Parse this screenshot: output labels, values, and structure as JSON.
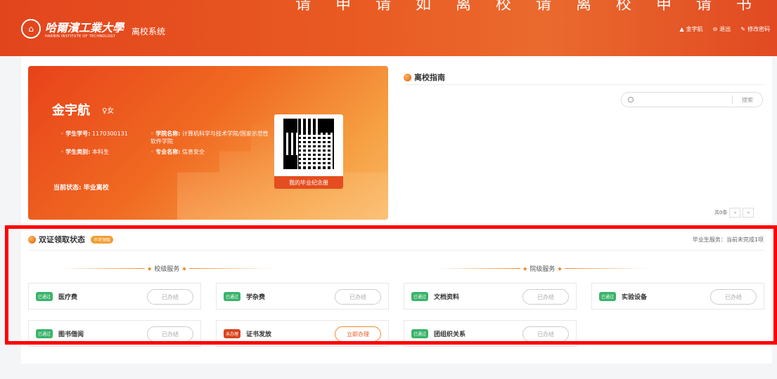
{
  "header": {
    "caption": "请 申 请 如 离 校 请 离 校 申 请 书",
    "logo_cn": "哈爾濱工業大學",
    "logo_en": "HARBIN INSTITUTE OF TECHNOLOGY",
    "system_title": "离校系统",
    "user_name": "金宇航",
    "logout_label": "退出",
    "change_password_label": "修改密码"
  },
  "student_card": {
    "name": "金宇航",
    "gender": "♀女",
    "student_id_label": "学生学号:",
    "student_id": "1170300131",
    "student_type_label": "学生类别:",
    "student_type": "本科生",
    "college_label": "学院名称:",
    "college": "计算机科学与技术学院/国家示范性软件学院",
    "major_label": "专业名称:",
    "major": "信息安全",
    "status_label": "当前状态:",
    "status": "毕业离校",
    "qr_caption": "我的毕业纪念册"
  },
  "guide": {
    "title": "离校指南",
    "search_placeholder": "",
    "search_button": "搜索",
    "total": "共0条",
    "prev": "«",
    "next": "»"
  },
  "certificates": {
    "title": "双证领取状态",
    "badge": "不可领取",
    "summary": "毕业生服务：当前未完成1项",
    "school_section": "校级服务",
    "college_section": "院级服务",
    "items": [
      {
        "tag": "已通过",
        "label": "医疗费",
        "action": "已办结"
      },
      {
        "tag": "已通过",
        "label": "学杂费",
        "action": "已办结"
      },
      {
        "tag": "已通过",
        "label": "文档资料",
        "action": "已办结"
      },
      {
        "tag": "已通过",
        "label": "实验设备",
        "action": "已办结"
      },
      {
        "tag": "已通过",
        "label": "图书借阅",
        "action": "已办结"
      },
      {
        "tag": "未办理",
        "label": "证书发放",
        "action": "立即办理"
      },
      {
        "tag": "已通过",
        "label": "团组织关系",
        "action": "已办结"
      }
    ]
  }
}
